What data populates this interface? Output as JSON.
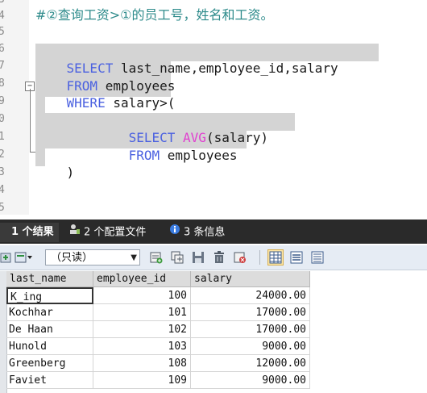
{
  "editor": {
    "comment": "#②查询工资>①的员工号，姓名和工资。",
    "line_numbers": [
      "3",
      "4",
      "5",
      "6",
      "7",
      "8",
      "9",
      "0",
      "1",
      "2",
      "3",
      "4",
      "5"
    ],
    "fold_marker": "−",
    "lines": [
      {
        "parts": [
          {
            "t": "SELECT",
            "k": "kw"
          },
          {
            "t": " last_name,employee_id,salary",
            "k": ""
          }
        ]
      },
      {
        "parts": [
          {
            "t": "FROM",
            "k": "kw"
          },
          {
            "t": " employees",
            "k": ""
          }
        ]
      },
      {
        "parts": [
          {
            "t": "WHERE",
            "k": "kw"
          },
          {
            "t": " salary>(",
            "k": ""
          }
        ]
      },
      {
        "parts": [
          {
            "t": "        SELECT",
            "k": "kw"
          },
          {
            "t": " ",
            "k": ""
          },
          {
            "t": "AVG",
            "k": "fn"
          },
          {
            "t": "(salary)",
            "k": ""
          }
        ]
      },
      {
        "parts": [
          {
            "t": "        FROM",
            "k": "kw"
          },
          {
            "t": " employees",
            "k": ""
          }
        ]
      },
      {
        "parts": [
          {
            "t": ")",
            "k": ""
          }
        ]
      }
    ]
  },
  "result_tabs": [
    {
      "label": "1 个结果",
      "icon": "grid-icon",
      "active": true
    },
    {
      "label": "2 个配置文件",
      "icon": "profile-icon",
      "active": false
    },
    {
      "label": "3 条信息",
      "icon": "info-icon",
      "active": false
    }
  ],
  "toolbar": {
    "mode_value": "（只读）",
    "mode_arrow": "▼"
  },
  "table": {
    "columns": [
      "last_name",
      "employee_id",
      "salary"
    ],
    "rows": [
      [
        "K_ing",
        "100",
        "24000.00"
      ],
      [
        "Kochhar",
        "101",
        "17000.00"
      ],
      [
        "De Haan",
        "102",
        "17000.00"
      ],
      [
        "Hunold",
        "103",
        "9000.00"
      ],
      [
        "Greenberg",
        "108",
        "12000.00"
      ],
      [
        "Faviet",
        "109",
        "9000.00"
      ]
    ]
  },
  "colors": {
    "keyword": "#4b61e0",
    "function": "#e040d0",
    "comment": "#2e8b8b",
    "selection": "#d4d4d4",
    "tabbar": "#2a2a2a"
  }
}
